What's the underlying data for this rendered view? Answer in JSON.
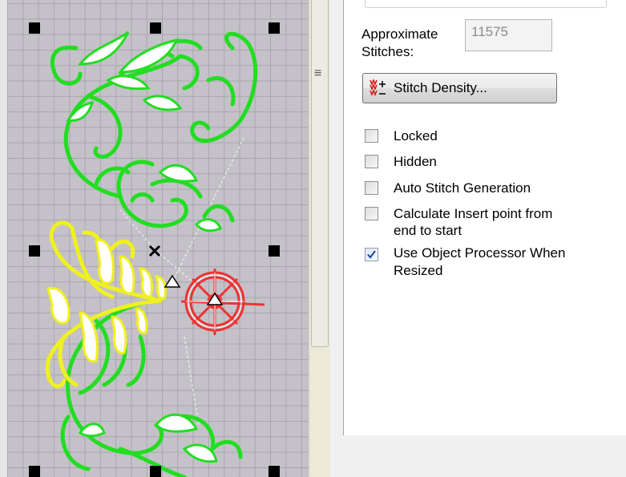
{
  "panel": {
    "approx_label_line1": "Approximate",
    "approx_label_line2": "Stitches:",
    "approx_value": "11575",
    "density_button": "Stitch Density...",
    "checkboxes": [
      {
        "label": "Locked",
        "checked": false
      },
      {
        "label": "Hidden",
        "checked": false
      },
      {
        "label": "Auto Stitch Generation",
        "checked": false
      },
      {
        "label_line1": "Calculate Insert point from",
        "label_line2": "end to start",
        "checked": false
      },
      {
        "label_line1": "Use Object Processor When",
        "label_line2": "Resized",
        "checked": true
      }
    ]
  },
  "icons": [
    "stitch-density-icon",
    "checkmark-icon",
    "splitter-grip-icon",
    "selection-handle",
    "center-x-marker",
    "triangle-marker"
  ],
  "colors": {
    "canvas_bg": "#c4c2c8",
    "green_thread": "#22dd22",
    "yellow_thread": "#f0f020",
    "red_thread": "#ee3333",
    "check_blue": "#2a4fa8"
  }
}
